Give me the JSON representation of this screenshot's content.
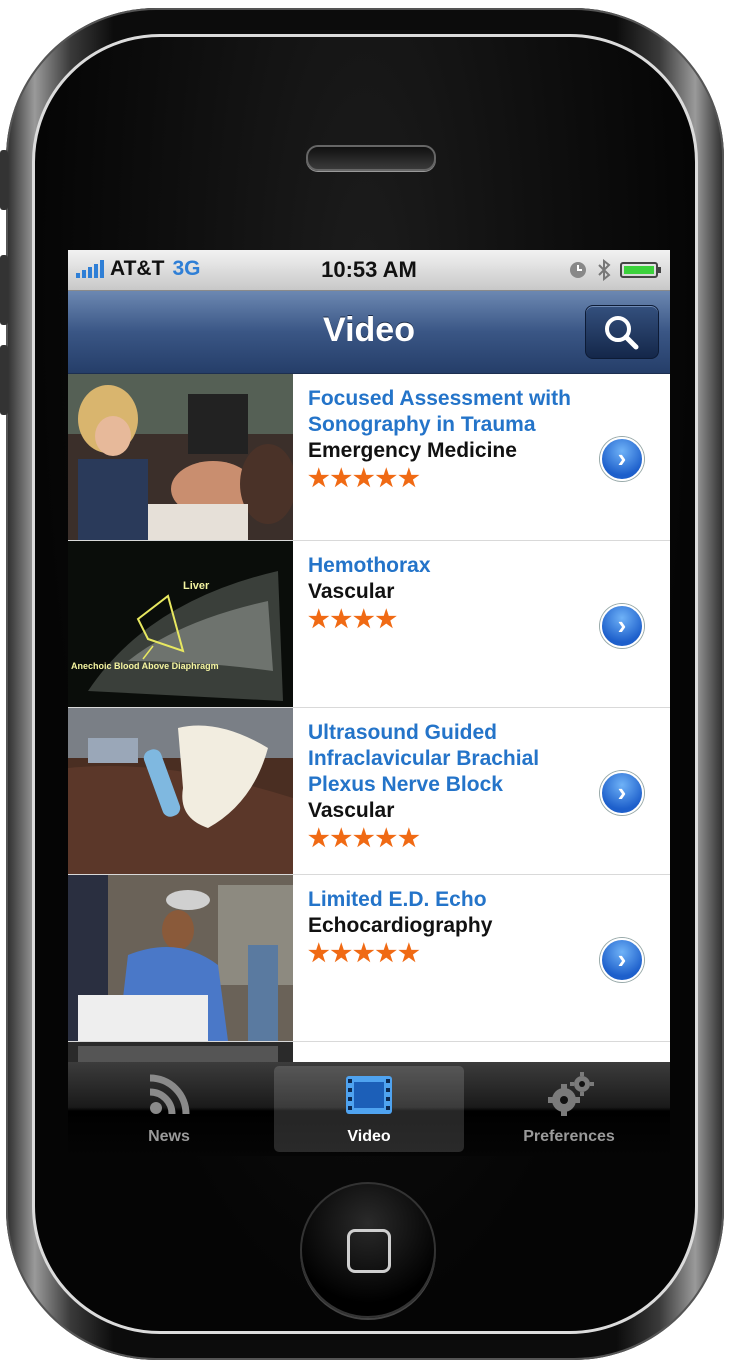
{
  "status_bar": {
    "carrier": "AT&T",
    "network": "3G",
    "time": "10:53 AM",
    "icons": [
      "signal-icon",
      "alarm-icon",
      "bluetooth-icon",
      "battery-icon"
    ]
  },
  "nav": {
    "title": "Video",
    "search_icon": "search-icon"
  },
  "videos": [
    {
      "title": "Focused Assessment with Sonography in Trauma",
      "category": "Emergency Medicine",
      "stars": "★★★★★",
      "rating": 5
    },
    {
      "title": "Hemothorax",
      "category": "Vascular",
      "stars": "★★★★",
      "rating": 4,
      "thumb_labels": [
        "Liver",
        "Anechoic Blood Above Diaphragm"
      ]
    },
    {
      "title": "Ultrasound Guided Infraclavicular Brachial Plexus Nerve Block",
      "category": "Vascular",
      "stars": "★★★★★",
      "rating": 5
    },
    {
      "title": "Limited E.D. Echo",
      "category": "Echocardiography",
      "stars": "★★★★★",
      "rating": 5
    }
  ],
  "tabs": [
    {
      "label": "News",
      "icon": "rss-icon",
      "active": false
    },
    {
      "label": "Video",
      "icon": "film-icon",
      "active": true
    },
    {
      "label": "Preferences",
      "icon": "gears-icon",
      "active": false
    }
  ],
  "colors": {
    "title_blue": "#2474c9",
    "star_orange": "#f06a14",
    "nav_blue": "#3a5685"
  }
}
